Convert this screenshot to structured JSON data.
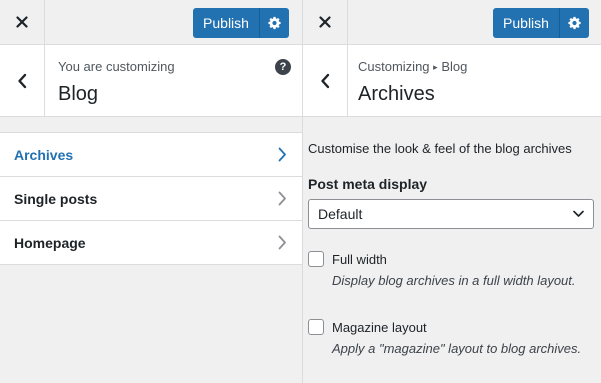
{
  "left_panel": {
    "publish_label": "Publish",
    "crumb": "You are customizing",
    "title": "Blog",
    "help_icon_text": "?",
    "menu_items": [
      {
        "label": "Archives"
      },
      {
        "label": "Single posts"
      },
      {
        "label": "Homepage"
      }
    ]
  },
  "right_panel": {
    "publish_label": "Publish",
    "crumb_parent": "Customizing",
    "crumb_separator": "▸",
    "crumb_current": "Blog",
    "title": "Archives",
    "description": "Customise the look & feel of the blog archives",
    "post_meta": {
      "label": "Post meta display",
      "selected": "Default"
    },
    "options": [
      {
        "label": "Full width",
        "description": "Display blog archives in a full width layout.",
        "checked": false
      },
      {
        "label": "Magazine layout",
        "description": "Apply a \"magazine\" layout to blog archives.",
        "checked": false
      }
    ]
  },
  "icons": {
    "close": "close-icon",
    "settings": "gear-icon",
    "back": "chevron-left-icon",
    "menu_arrow": "chevron-right-icon",
    "select_arrow": "chevron-down-icon"
  },
  "colors": {
    "accent": "#2271b1",
    "background": "#f0f0f1",
    "surface": "#ffffff",
    "border": "#dcdcde",
    "text": "#1d2327"
  }
}
